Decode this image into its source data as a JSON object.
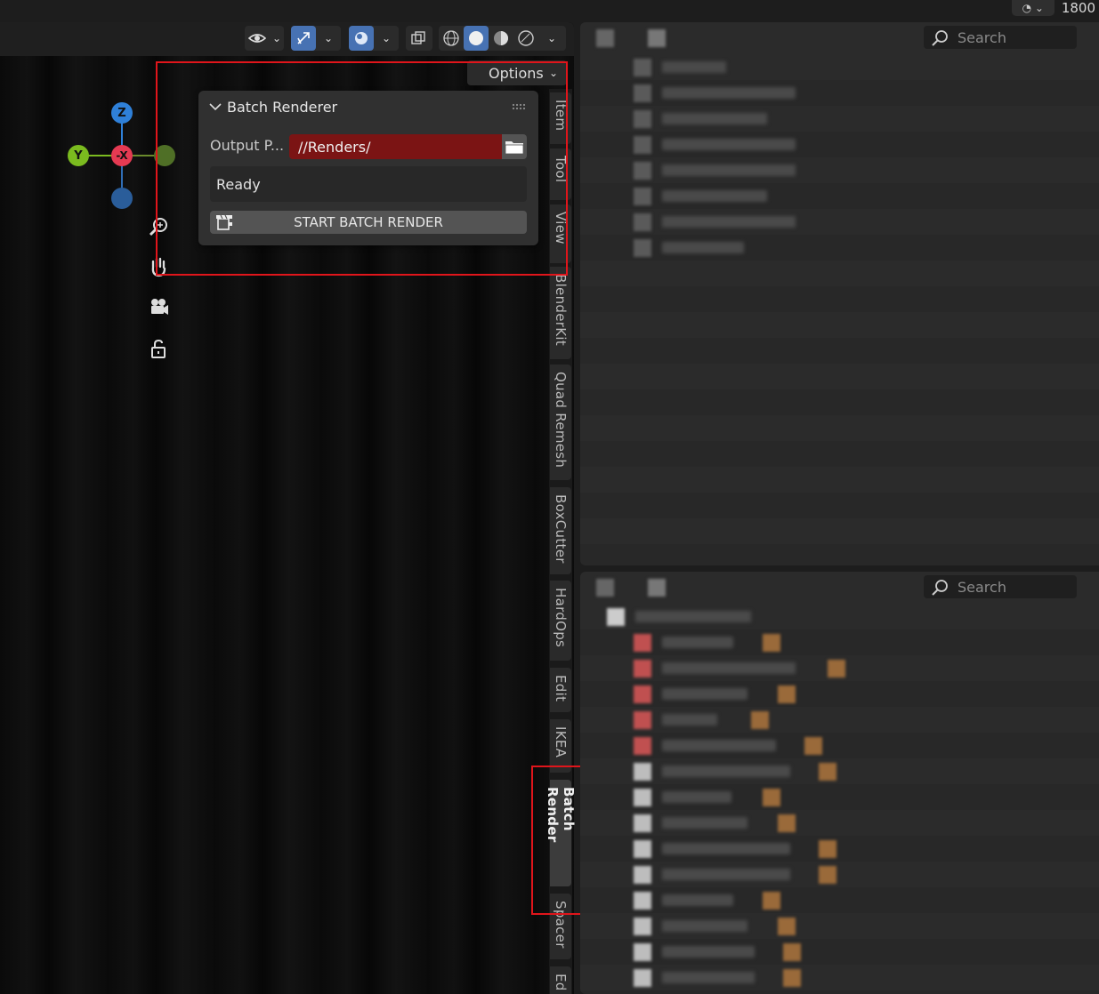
{
  "top_bar": {
    "frame_number": "1800"
  },
  "viewport": {
    "options_label": "Options",
    "gizmo": {
      "z": "Z",
      "y": "Y",
      "neg_x": "-X"
    }
  },
  "panel": {
    "title": "Batch Renderer",
    "output_label": "Output P...",
    "output_value": "//Renders/",
    "status": "Ready",
    "start_button": "START BATCH RENDER"
  },
  "tabs": [
    "Item",
    "Tool",
    "View",
    "BlenderKit",
    "Quad Remesh",
    "BoxCutter",
    "HardOps",
    "Edit",
    "IKEA",
    "Batch Render",
    "Spacer",
    "Ed"
  ],
  "active_tab": "Batch Render",
  "outliner_top": {
    "search_placeholder": "Search"
  },
  "outliner_bottom": {
    "search_placeholder": "Search"
  },
  "colors": {
    "accent": "#4772b3",
    "output_field": "#7b1414",
    "highlight": "#e0151b",
    "axis_x": "#e53a52",
    "axis_y": "#7bbb1f",
    "axis_z": "#2f80d8"
  }
}
